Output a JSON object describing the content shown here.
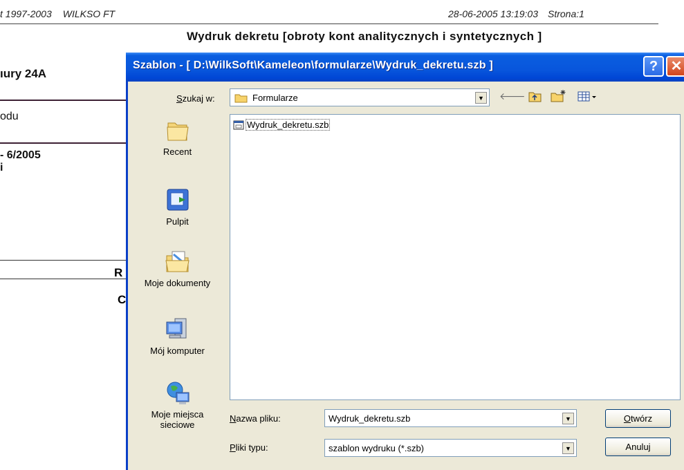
{
  "report": {
    "copyright": "t 1997-2003",
    "vendor": "WILKSO FT",
    "datetime": "28-06-2005 13:19:03",
    "page": "Strona:1",
    "title": "Wydruk dekretu [obroty kont analitycznych i syntetycznych ]",
    "address": "ıury 24A",
    "code": "odu",
    "period": "- 6/2005",
    "period_line2": "i",
    "letter_r": "R",
    "letter_c": "C"
  },
  "dialog": {
    "title": "Szablon - [ D:\\WilkSoft\\Kameleon\\formularze\\Wydruk_dekretu.szb ]",
    "help_label": "?",
    "close_label": "✕",
    "look_in_label": "Szukaj w:",
    "look_in_accel": "S",
    "look_in_rest": "zukaj w:",
    "look_in_value": "Formularze",
    "places": [
      {
        "label": "Recent",
        "icon": "recent-folder-icon"
      },
      {
        "label": "Pulpit",
        "icon": "desktop-icon"
      },
      {
        "label": "Moje dokumenty",
        "icon": "my-documents-icon"
      },
      {
        "label": "Mój komputer",
        "icon": "my-computer-icon"
      },
      {
        "label": "Moje miejsca sieciowe",
        "icon": "network-places-icon"
      }
    ],
    "files": [
      {
        "name": "Wydruk_dekretu.szb",
        "icon": "template-file-icon"
      }
    ],
    "filename_label_accel": "N",
    "filename_label_rest": "azwa pliku:",
    "filename_value": "Wydruk_dekretu.szb",
    "filetype_label_accel": "P",
    "filetype_label_rest": "liki typu:",
    "filetype_value": "szablon wydruku (*.szb)",
    "open_accel": "O",
    "open_rest": "twórz",
    "cancel_label": "Anuluj"
  },
  "colors": {
    "titlebar": "#0856dc",
    "dialog_bg": "#ece9d8",
    "close_button": "#d2451c"
  }
}
